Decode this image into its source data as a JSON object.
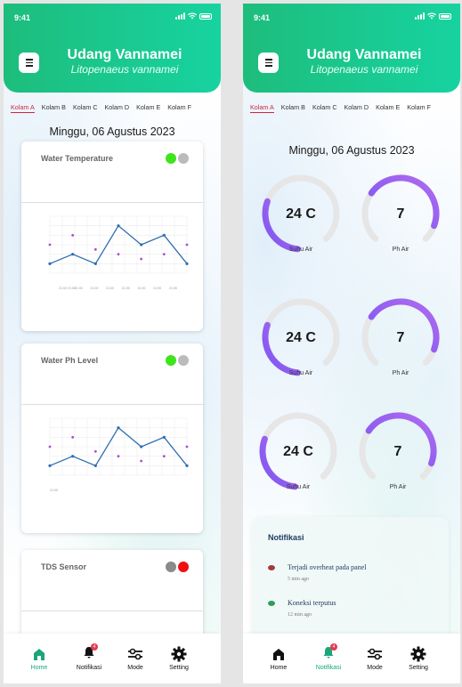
{
  "status_bar": {
    "time": "9:41"
  },
  "app": {
    "title": "Udang Vannamei",
    "subtitle": "Litopenaeus vannamei"
  },
  "tabs": [
    {
      "label": "Kolam A",
      "active": true
    },
    {
      "label": "Kolam B",
      "active": false
    },
    {
      "label": "Kolam C",
      "active": false
    },
    {
      "label": "Kolam D",
      "active": false
    },
    {
      "label": "Kolam E",
      "active": false
    },
    {
      "label": "Kolam F",
      "active": false
    }
  ],
  "date": "Minggu, 06 Agustus 2023",
  "colors": {
    "header_start": "#1dbd7c",
    "header_end": "#17d3a0",
    "active_tab": "#d0233e",
    "gauge_start": "#7b55f0",
    "gauge_end": "#b06cf0",
    "line": "#2e6eb0",
    "scatter": "#a64fd1"
  },
  "cards": [
    {
      "title": "Water Temperature",
      "status_colors": [
        "#3ee51c",
        "#bbbbbb"
      ]
    },
    {
      "title": "Water Ph Level",
      "status_colors": [
        "#3ee51c",
        "#bbbbbb"
      ]
    },
    {
      "title": "TDS Sensor",
      "status_colors": [
        "#8a8a8a",
        "#f01010"
      ]
    }
  ],
  "chart_data": [
    {
      "type": "line",
      "x_tick_labels": [
        "21:00 21:00",
        "21:00",
        "21:00",
        "21:00",
        "21:00",
        "21:00",
        "21:00",
        "21:00"
      ],
      "series": [
        {
          "values": [
            1,
            2,
            1,
            5,
            3,
            4,
            1
          ]
        },
        {
          "values": [
            3,
            4,
            2.5,
            2,
            1.5,
            2,
            3
          ]
        }
      ]
    },
    {
      "type": "line",
      "x_tick_labels": [
        "21:00"
      ],
      "series": [
        {
          "values": [
            1,
            2,
            1,
            5,
            3,
            4,
            1
          ]
        },
        {
          "values": [
            3,
            4,
            2.5,
            2,
            1.5,
            2,
            3
          ]
        }
      ]
    }
  ],
  "gauges": [
    {
      "value": "24 C",
      "label": "Suhu Air",
      "level": 0.3
    },
    {
      "value": "7",
      "label": "Ph Air",
      "level": 0.55
    },
    {
      "value": "24 C",
      "label": "Suhu Air",
      "level": 0.3
    },
    {
      "value": "7",
      "label": "Ph Air",
      "level": 0.55
    },
    {
      "value": "24 C",
      "label": "Suhu Air",
      "level": 0.3
    },
    {
      "value": "7",
      "label": "Ph Air",
      "level": 0.55
    }
  ],
  "notifications": {
    "heading": "Notifikasi",
    "items": [
      {
        "text": "Terjadi overheat pada panel",
        "time": "5 min ago",
        "color": "#a23b3b"
      },
      {
        "text": "Koneksi terputus",
        "time": "12 min ago",
        "color": "#2e9e54"
      }
    ]
  },
  "nav": {
    "items": [
      {
        "label": "Home",
        "icon": "home-icon"
      },
      {
        "label": "Notifikasi",
        "icon": "bell-icon",
        "badge": "4"
      },
      {
        "label": "Mode",
        "icon": "sliders-icon"
      },
      {
        "label": "Setting",
        "icon": "gear-icon"
      }
    ],
    "active_left": "Home",
    "active_right": "Notifikasi"
  }
}
